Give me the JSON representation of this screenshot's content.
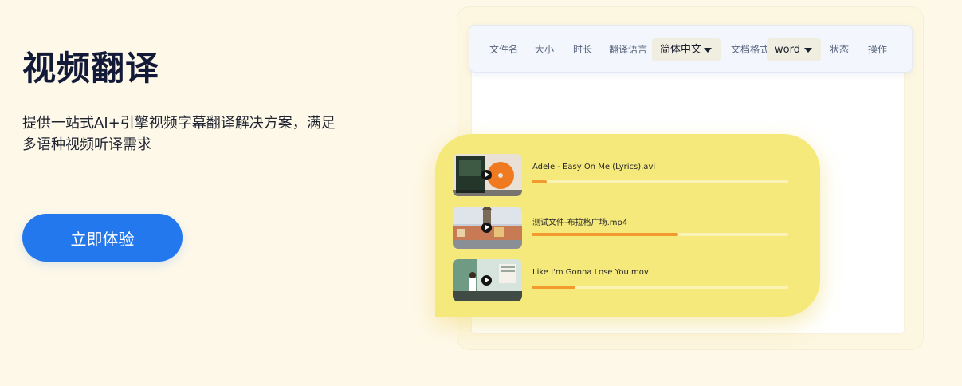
{
  "hero": {
    "title": "视频翻译",
    "description": "提供一站式AI+引擎视频字幕翻译解决方案，满足多语种视频听译需求",
    "cta_label": "立即体验"
  },
  "toolbar": {
    "col_filename": "文件名",
    "col_size": "大小",
    "col_duration": "时长",
    "col_target_lang": "翻译语言",
    "lang_value": "简体中文",
    "col_doc_format": "文档格式",
    "format_value": "word",
    "col_status": "状态",
    "col_actions": "操作"
  },
  "files": [
    {
      "name": "Adele - Easy On Me (Lyrics).avi",
      "progress": 0.06
    },
    {
      "name": "测试文件-布拉格广场.mp4",
      "progress": 0.57
    },
    {
      "name": "Like I'm Gonna Lose You.mov",
      "progress": 0.17
    }
  ],
  "colors": {
    "page_bg": "#fef8e9",
    "title": "#131a38",
    "cta": "#2378ee",
    "panel": "#f5e97c",
    "progress_fill": "#f29a2e",
    "progress_track": "#fbf3b6"
  },
  "icons": {
    "select_caret": "caret-down-icon",
    "play": "play-icon"
  }
}
